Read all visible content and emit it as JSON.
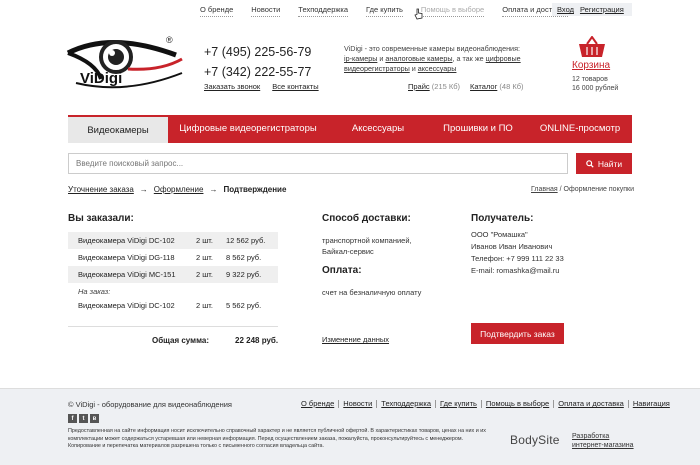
{
  "topnav": {
    "items": [
      "О бренде",
      "Новости",
      "Техподдержка",
      "Где купить",
      "Помощь в выборе",
      "Оплата и доставка"
    ],
    "login": "Вход",
    "register": "Регистрация"
  },
  "logo": {
    "text": "ViDigi",
    "registered": "®"
  },
  "header": {
    "phone1": "+7 (495) 225-56-79",
    "phone2": "+7 (342) 222-55-77",
    "order_call": "Заказать звонок",
    "all_contacts": "Все контакты",
    "about_brand": "ViDigi",
    "about_1": " - это современные камеры видеонаблюдения:",
    "about_ip": "ip-камеры",
    "about_and": " и ",
    "about_analog": "аналоговые камеры",
    "about_2": ", а так же ",
    "about_dvr": "цифровые видеорегистраторы",
    "about_and2": " и ",
    "about_acc": "аксессуары",
    "price_label": "Прайс",
    "price_size": "(215 Кб)",
    "catalog_label": "Каталог",
    "catalog_size": "(48 Кб)"
  },
  "cart": {
    "title": "Корзина",
    "items": "12 товаров",
    "sum": "16 000 рублей"
  },
  "menu": [
    "Видеокамеры",
    "Цифровые видеорегистраторы",
    "Аксессуары",
    "Прошивки и ПО",
    "ONLINE-просмотр"
  ],
  "search": {
    "placeholder": "Введите поисковый запрос...",
    "button": "Найти"
  },
  "steps": {
    "step1": "Уточнение заказа",
    "arrow": "→",
    "step2": "Оформление",
    "step3": "Подтверждение"
  },
  "breadcrumb": {
    "home": "Главная",
    "sep": " / ",
    "current": "Оформление покупки"
  },
  "order": {
    "title": "Вы заказали:",
    "items": [
      {
        "name": "Видеокамера ViDigi DC-102",
        "qty": "2 шт.",
        "price": "12 562 руб."
      },
      {
        "name": "Видеокамера ViDigi DG-118",
        "qty": "2 шт.",
        "price": "8 562 руб."
      },
      {
        "name": "Видеокамера ViDigi MC-151",
        "qty": "2 шт.",
        "price": "9 322 руб."
      }
    ],
    "preorder_label": "На заказ:",
    "preorder_items": [
      {
        "name": "Видеокамера ViDigi DC-102",
        "qty": "2 шт.",
        "price": "5 562 руб."
      }
    ],
    "total_label": "Общая сумма:",
    "total_value": "22 248 руб."
  },
  "delivery": {
    "title": "Способ доставки:",
    "line1": "транспортной компанией,",
    "line2": "Байкал-сервис",
    "pay_title": "Оплата:",
    "pay_value": "счет на безналичную оплату",
    "edit": "Изменение данных"
  },
  "receiver": {
    "title": "Получатель:",
    "company": "ООО \"Ромашка\"",
    "name": "Иванов Иван Иванович",
    "phone": "Телефон: +7 999 111 22 33",
    "email": "E-mail: romashka@mail.ru",
    "confirm": "Подтвердить заказ"
  },
  "footer": {
    "copyright": "© ViDigi - оборудование для видеонаблюдения",
    "nav": [
      "О бренде",
      "Новости",
      "Техподдержка",
      "Где купить",
      "Помощь в выборе",
      "Оплата и доставка",
      "Навигация"
    ],
    "socials": [
      "f",
      "t",
      "в"
    ],
    "disclaimer": "Предоставленная на сайте информация носит исключительно справочный характер и не является публичной офертой. В характеристиках товаров, ценах на них и их комплектации может содержаться устаревшая или неверная информация. Перед осуществлением заказа, пожалуйста, проконсультируйтесь с менеджером. Копирование и перепечатка материалов разрешена только с письменного согласия владельца сайта.",
    "bodysite": "BodySite",
    "dev1": "Разработка",
    "dev2": "интернет-магазина"
  },
  "colors": {
    "accent": "#c8232a",
    "footer_bg": "#eef0f3"
  }
}
